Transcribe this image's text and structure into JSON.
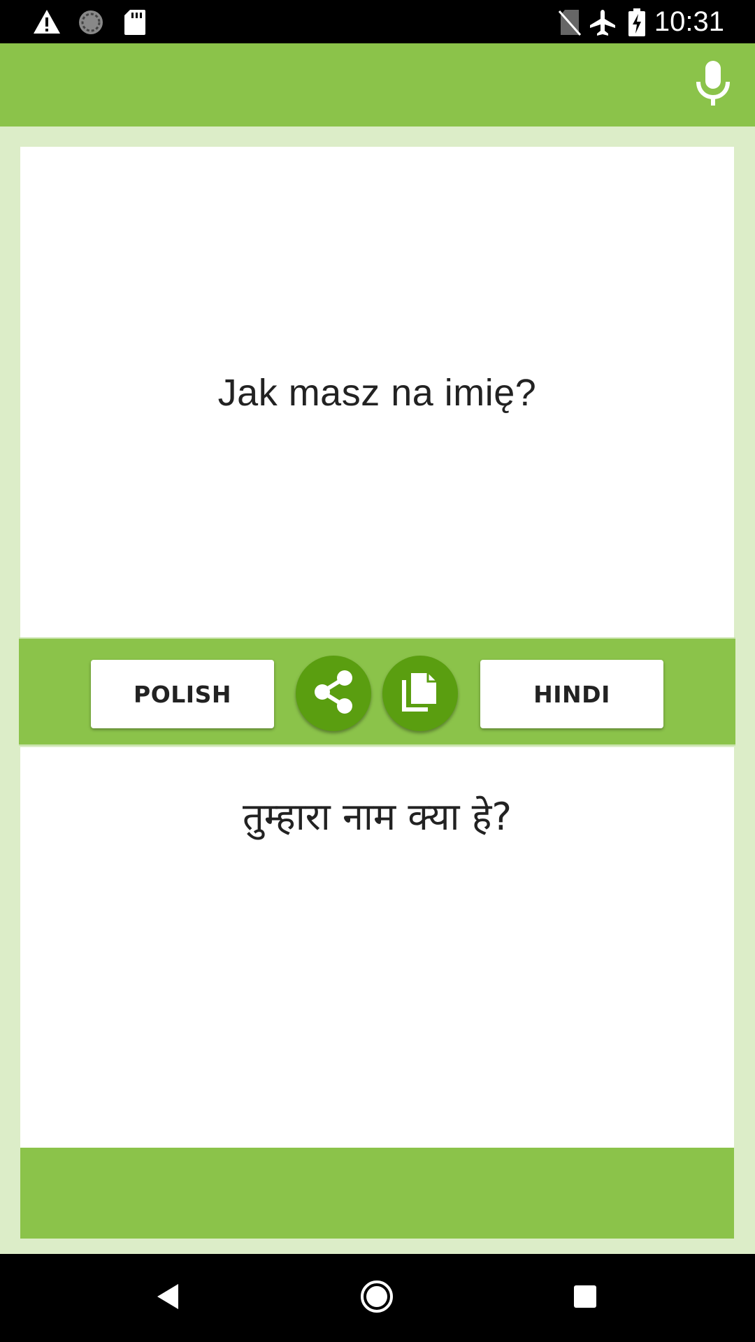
{
  "status_bar": {
    "time": "10:31",
    "icons": [
      "warning-icon",
      "sync-icon",
      "sd-card-icon",
      "no-sim-icon",
      "airplane-mode-icon",
      "battery-charging-icon"
    ]
  },
  "toolbar": {
    "mic_icon": "microphone-icon"
  },
  "translation": {
    "source_text": "Jak masz na imię?",
    "target_text": "तुम्हारा नाम क्या हे?"
  },
  "controls": {
    "source_language": "POLISH",
    "target_language": "HINDI",
    "share_icon": "share-icon",
    "copy_icon": "copy-icon"
  },
  "nav_bar": {
    "icons": [
      "back-icon",
      "home-icon",
      "recents-icon"
    ]
  },
  "colors": {
    "primary": "#8bc34a",
    "primary_dark": "#5a9e10",
    "background": "#dcedc8"
  }
}
